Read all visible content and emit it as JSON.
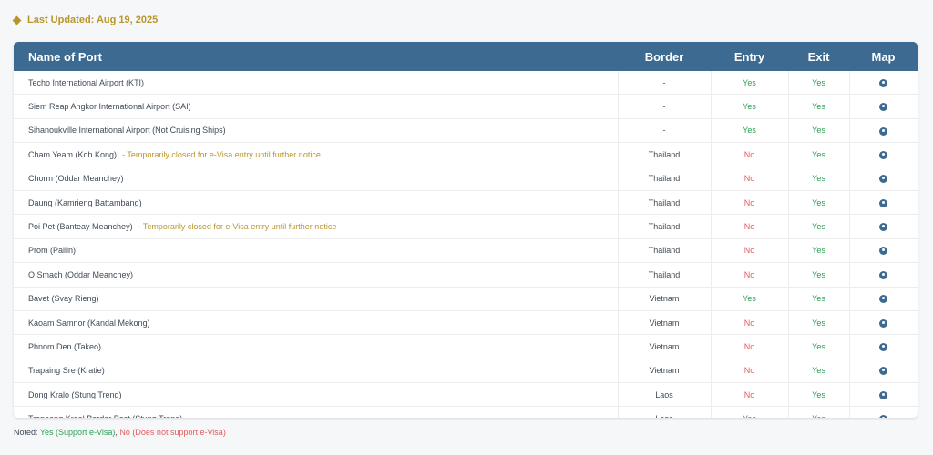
{
  "last_updated": "Last Updated: Aug 19, 2025",
  "table": {
    "headers": {
      "port": "Name of Port",
      "border": "Border",
      "entry": "Entry",
      "exit": "Exit",
      "map": "Map"
    },
    "rows": [
      {
        "port": "Techo International Airport (KTI)",
        "note": "",
        "border": "-",
        "entry": "Yes",
        "exit": "Yes"
      },
      {
        "port": "Siem Reap Angkor International Airport (SAI)",
        "note": "",
        "border": "-",
        "entry": "Yes",
        "exit": "Yes"
      },
      {
        "port": "Sihanoukville International Airport (Not Cruising Ships)",
        "note": "",
        "border": "-",
        "entry": "Yes",
        "exit": "Yes"
      },
      {
        "port": "Cham Yeam (Koh Kong)",
        "note": "- Temporarily closed for e-Visa entry until further notice",
        "border": "Thailand",
        "entry": "No",
        "exit": "Yes"
      },
      {
        "port": "Chorm (Oddar Meanchey)",
        "note": "",
        "border": "Thailand",
        "entry": "No",
        "exit": "Yes"
      },
      {
        "port": "Daung (Kamrieng Battambang)",
        "note": "",
        "border": "Thailand",
        "entry": "No",
        "exit": "Yes"
      },
      {
        "port": "Poi Pet (Banteay Meanchey)",
        "note": "- Temporarily closed for e-Visa entry until further notice",
        "border": "Thailand",
        "entry": "No",
        "exit": "Yes"
      },
      {
        "port": "Prom (Pailin)",
        "note": "",
        "border": "Thailand",
        "entry": "No",
        "exit": "Yes"
      },
      {
        "port": "O Smach (Oddar Meanchey)",
        "note": "",
        "border": "Thailand",
        "entry": "No",
        "exit": "Yes"
      },
      {
        "port": "Bavet (Svay Rieng)",
        "note": "",
        "border": "Vietnam",
        "entry": "Yes",
        "exit": "Yes"
      },
      {
        "port": "Kaoam Samnor (Kandal Mekong)",
        "note": "",
        "border": "Vietnam",
        "entry": "No",
        "exit": "Yes"
      },
      {
        "port": "Phnom Den (Takeo)",
        "note": "",
        "border": "Vietnam",
        "entry": "No",
        "exit": "Yes"
      },
      {
        "port": "Trapaing Sre (Kratie)",
        "note": "",
        "border": "Vietnam",
        "entry": "No",
        "exit": "Yes"
      },
      {
        "port": "Dong Kralo (Stung Treng)",
        "note": "",
        "border": "Laos",
        "entry": "No",
        "exit": "Yes"
      },
      {
        "port": "Tropaeng Kreal Border Post (Stung Treng)",
        "note": "",
        "border": "Laos",
        "entry": "Yes",
        "exit": "Yes"
      }
    ],
    "map_icon": "map-pin-icon"
  },
  "footer": {
    "prefix": "Noted: ",
    "yes_text": "Yes (Support e-Visa)",
    "separator": ", ",
    "no_text": "No (Does not support e-Visa)"
  },
  "colors": {
    "header_bg": "#3c6a91",
    "yes": "#2e9e55",
    "no": "#e15b5b",
    "accent": "#b8962e"
  }
}
